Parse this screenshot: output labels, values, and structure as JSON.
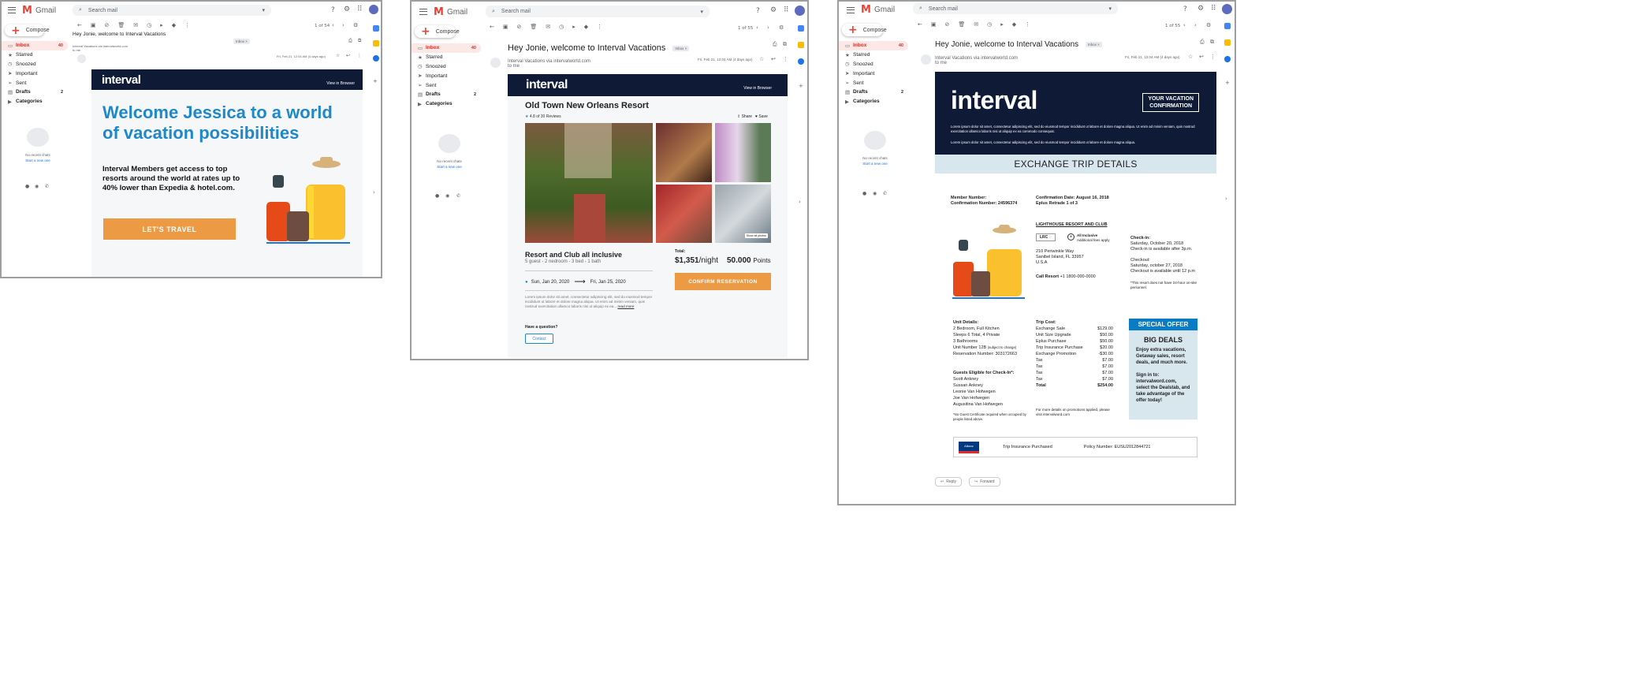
{
  "gmail": {
    "app_name": "Gmail",
    "search_placeholder": "Search mail",
    "compose": "Compose",
    "inbox_chip": "Inbox ×",
    "reply": "Reply",
    "forward": "Forward",
    "no_chats": "No recent chats",
    "start_chat": "Start a new one",
    "to_me": "to me"
  },
  "nav": [
    {
      "label": "Inbox",
      "count": "40",
      "icon": "inbox-icon",
      "glyph": "▭"
    },
    {
      "label": "Starred",
      "icon": "star-icon",
      "glyph": "★"
    },
    {
      "label": "Snoozed",
      "icon": "clock-icon",
      "glyph": "◷"
    },
    {
      "label": "Important",
      "icon": "important-icon",
      "glyph": "➤"
    },
    {
      "label": "Sent",
      "icon": "send-icon",
      "glyph": "➢"
    },
    {
      "label": "Drafts",
      "count": "2",
      "icon": "draft-icon",
      "glyph": "▤"
    },
    {
      "label": "Categories",
      "icon": "label-icon",
      "glyph": "▶"
    }
  ],
  "window1": {
    "pager": "1 of 54",
    "subject": "Hey Jonie, welcome to Interval Vacations",
    "sender": "Interval Vacations via intervalworld.com",
    "date": "Fri, Feb 21, 12:04 AM (4 days ago)",
    "logo": "interval",
    "view_browser": "View in Browser",
    "headline": "Welcome Jessica to a world of vacation possibilities",
    "body": "Interval Members get access to top resorts around the world at rates up to 40% lower than Expedia & hotel.com.",
    "cta": "LET'S TRAVEL"
  },
  "window2": {
    "pager": "1 of 55",
    "subject": "Hey Jonie, welcome to Interval Vacations",
    "sender": "Interval Vacations via intervalworld.com",
    "date": "Fri, Feb 21, 12:04 AM (4 days ago)",
    "logo": "interval",
    "view_browser": "View in Browser",
    "resort": "Old Town New Orleans Resort",
    "rating": "4.8 of 30 Reviews",
    "share": "Share",
    "save": "Save",
    "show_photos": "Show all photos",
    "package": "Resort and Club all inclusive",
    "details": "5 guest - 2 nedroom - 3 bed - 1 bath",
    "date_from": "Sun, Jan 20, 2020",
    "date_to": "Fri, Jan 25, 2020",
    "total_label": "Total:",
    "price": "$1,351",
    "per_night": "/night",
    "points": "50.000",
    "points_label": "Points",
    "confirm": "CONFIRM RESERVATION",
    "lorem": "Lorem ipsum dolor sit amet, consectetur adipiscing elit, sed do eiusmod tempor incididunt ut labore et dolore magna aliqua. Ut enim ad minim veniam, quis nostrud exercitation ullamco laboris nisi ut aliquip ex ea...",
    "read_more": "read more",
    "question": "Have a question?",
    "contact": "Contact"
  },
  "window3": {
    "pager": "1 of 55",
    "subject": "Hey Jonie, welcome to Interval Vacations",
    "sender": "Interval Vacations via intervalworld.com",
    "date": "Fri, Feb 21, 12:04 AM (4 days ago)",
    "logo": "interval",
    "conf_badge_1": "YOUR VACATION",
    "conf_badge_2": "CONFIRMATION",
    "lorem1": "Lorem ipsum dolor sit amet, consectetur adipiscing elit, sed do eiusmod tempor incididunt ut labore et dolore magna aliqua. Ut enim ad minim veniam, quis nostrud exercitation ullamco laboris nisi ut aliquip ex ea commodo consequat.",
    "lorem2": "Lorem ipsum dolor sit amet, consectetur adipiscing elit, sed do eiusmod tempor incididunt ut labore et dolore magna aliqua.",
    "exchange": "EXCHANGE TRIP DETAILS",
    "member": "Member Number:",
    "conf_number": "Confirmation Number: 24596374",
    "conf_date": "Confirmation Date: August 16, 2018",
    "eplus": "Eplus Retrade 1 of 3",
    "resort": "LIGHTHOUSE RESORT AND CLUB",
    "lrc": "LRC",
    "all_incl": "All Inclusive",
    "fees": "Additional fees apply",
    "addr1": "210 Periwinkle Way",
    "addr2": "Sanibel Island, FL 33957",
    "addr3": "U.S.A",
    "call_label": "Call Resort",
    "phone": "+1 1800-000-0000",
    "checkin": "Check-in:",
    "checkin_date": "Saturday, October 20, 2018",
    "checkin_note": "Check-in is available after 3p.m.",
    "checkout": "Checkout:",
    "checkout_date": "Saturday, october 27, 2018",
    "checkout_note": "Checkout is available until 12 p.m",
    "note24": "*This resort does not have 24-hour on-site personnel.",
    "unit_title": "Unit Details:",
    "unit": [
      "2 Bedroom, Full Kitchen",
      "Sleeps 6 Total, 4 Private",
      "3 Bathrooms",
      "Unit Number 12B",
      "Reservation Number: 303172663"
    ],
    "unit_sub": "(subject to change)",
    "guests_title": "Guests Eligible for Check-In*:",
    "guests": [
      "Scott Ankney",
      "Sussan Ankney",
      "Leonie Van Hofwegen",
      "Joe Van Hofwegen",
      "Augusitina Van Hofwegen"
    ],
    "guest_note": "*No Guest Certificate required when occupied by people listed above.",
    "trip_title": "Trip Cost:",
    "trip": [
      [
        "Exchange Sale",
        "$129.00"
      ],
      [
        "Unit Size Upgrade",
        "$50.00"
      ],
      [
        "Eplus Purchase",
        "$50.00"
      ],
      [
        "Trip Insurance Purchase",
        "$20.00"
      ],
      [
        "Exchange Promotion",
        "-$30.00"
      ],
      [
        "Tax",
        "$7.00"
      ],
      [
        "Tax",
        "$7.00"
      ],
      [
        "Tax",
        "$7.00"
      ],
      [
        "Tax",
        "$7.00"
      ],
      [
        "Total",
        "$254.00"
      ]
    ],
    "promo_note": "For more details on promotions applied, please visit intervalword.com",
    "special": "SPECIAL OFFER",
    "big": "BIG DEALS",
    "big_text": "Enjoy extra vacations, Getaway sales, resort deals, and much more.",
    "signin": "Sign in to: intervalword.com, select the Dealstab, and take advantage of the offer today!",
    "allianz": "Allianz",
    "insurance": "Trip Insurance Purchased",
    "policy": "Policy Number: EUSU2012844721"
  }
}
